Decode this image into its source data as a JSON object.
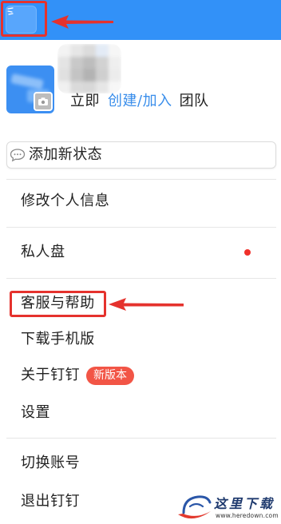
{
  "header": {
    "background": "#3291F8",
    "avatar_icon": "app-avatar-icon"
  },
  "annotations": {
    "color": "#E5322D",
    "arrow_icon": "left-arrow-icon"
  },
  "profile": {
    "avatar_icon": "team-avatar",
    "badge_icon": "camera-icon",
    "team_prefix": "立即",
    "team_link": "创建/加入",
    "team_suffix": "团队",
    "link_color": "#3A8EEB"
  },
  "status": {
    "icon": "speech-bubble-icon",
    "label": "添加新状态"
  },
  "menu": {
    "items": [
      {
        "label": "修改个人信息"
      },
      {
        "label": "私人盘"
      },
      {
        "label": "客服与帮助"
      },
      {
        "label": "下载手机版"
      },
      {
        "label": "关于钉钉",
        "badge": "新版本"
      },
      {
        "label": "设置"
      },
      {
        "label": "切换账号"
      },
      {
        "label": "退出钉钉"
      }
    ],
    "badge_color": "#F25546",
    "dot_color": "#F0302A"
  },
  "watermark": {
    "title": "这里下载",
    "url": "www.heredown.com"
  }
}
